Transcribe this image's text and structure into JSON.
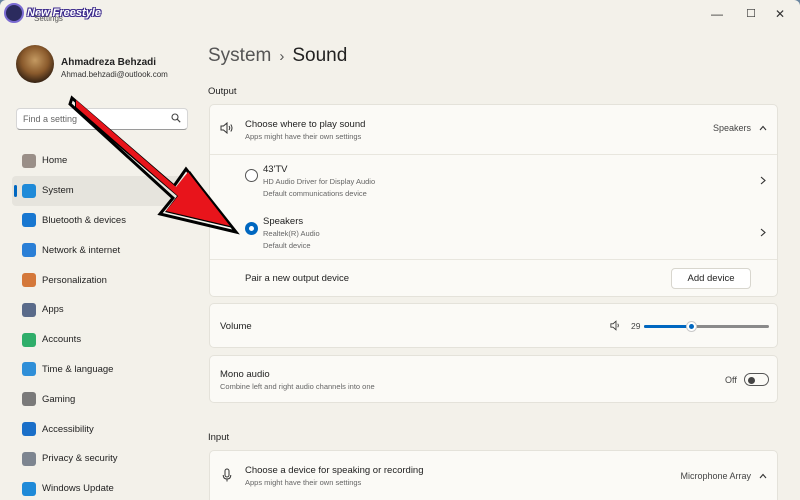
{
  "branding": {
    "watermark_text": "New Freestyle",
    "app_title": "Settings"
  },
  "window_controls": {
    "minimize": "—",
    "maximize": "☐",
    "close": "✕"
  },
  "user": {
    "name": "Ahmadreza Behzadi",
    "email": "Ahmad.behzadi@outlook.com"
  },
  "search": {
    "placeholder": "Find a setting"
  },
  "sidebar": {
    "items": [
      {
        "label": "Home",
        "icon": "home-icon",
        "color": "#9a8f88",
        "active": false
      },
      {
        "label": "System",
        "icon": "system-icon",
        "color": "#1f8ad8",
        "active": true
      },
      {
        "label": "Bluetooth & devices",
        "icon": "bluetooth-icon",
        "color": "#1877d0",
        "active": false
      },
      {
        "label": "Network & internet",
        "icon": "network-icon",
        "color": "#2a7fd6",
        "active": false
      },
      {
        "label": "Personalization",
        "icon": "personalization-icon",
        "color": "#d4783a",
        "active": false
      },
      {
        "label": "Apps",
        "icon": "apps-icon",
        "color": "#5a6b8a",
        "active": false
      },
      {
        "label": "Accounts",
        "icon": "accounts-icon",
        "color": "#2fae6a",
        "active": false
      },
      {
        "label": "Time & language",
        "icon": "time-language-icon",
        "color": "#2f8fd8",
        "active": false
      },
      {
        "label": "Gaming",
        "icon": "gaming-icon",
        "color": "#7a7a7a",
        "active": false
      },
      {
        "label": "Accessibility",
        "icon": "accessibility-icon",
        "color": "#1a6fc8",
        "active": false
      },
      {
        "label": "Privacy & security",
        "icon": "shield-icon",
        "color": "#7d8590",
        "active": false
      },
      {
        "label": "Windows Update",
        "icon": "windows-update-icon",
        "color": "#1f8ad8",
        "active": false
      }
    ]
  },
  "breadcrumb": {
    "parent": "System",
    "separator": "›",
    "current": "Sound"
  },
  "output": {
    "heading": "Output",
    "choose": {
      "title": "Choose where to play sound",
      "subtitle": "Apps might have their own settings",
      "value": "Speakers"
    },
    "devices": [
      {
        "name": "43'TV",
        "line1": "HD Audio Driver for Display Audio",
        "line2": "Default communications device",
        "selected": false
      },
      {
        "name": "Speakers",
        "line1": "Realtek(R) Audio",
        "line2": "Default device",
        "selected": true
      }
    ],
    "pair": {
      "label": "Pair a new output device",
      "button": "Add device"
    },
    "volume": {
      "label": "Volume",
      "value": "29",
      "level": 0.29
    },
    "mono": {
      "title": "Mono audio",
      "subtitle": "Combine left and right audio channels into one",
      "state": "Off"
    }
  },
  "input": {
    "heading": "Input",
    "choose": {
      "title": "Choose a device for speaking or recording",
      "subtitle": "Apps might have their own settings",
      "value": "Microphone Array"
    }
  },
  "colors": {
    "accent": "#0067c0",
    "arrow": "#e8141b"
  }
}
